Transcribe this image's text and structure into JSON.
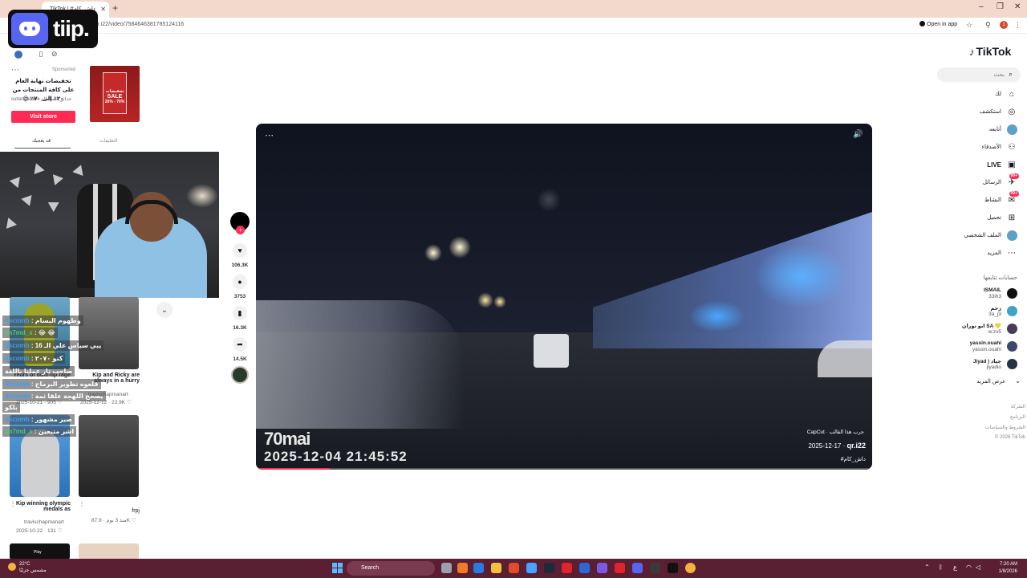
{
  "browser": {
    "tab_title": "TikTok | #داش_كام",
    "url": "qr.i22/video/7584646381785124116",
    "open_in_app": "Open in app",
    "notification_count": "1"
  },
  "overlay": {
    "logo_text": "tiip."
  },
  "ad": {
    "sponsored": "Sponsored",
    "text": "تخفيضات نهاية العام على كافة المنتجات من ٢٠٪ إلى ٧٠٪ 😍",
    "handle": "sultangarden",
    "handle_ar": "حدائق السلطان",
    "img_text": "SALE",
    "img_discount": "20% - 70%",
    "img_heading": "تخفيضات",
    "visit_label": "Visit store"
  },
  "left_tabs": {
    "tab1": "قد يعجبك",
    "tab2": "التعليقات"
  },
  "chat": [
    {
      "user": "itscomb",
      "msg": "وطهوم البسام",
      "user_class": "u"
    },
    {
      "user": "im7md_x",
      "msg": "😂 😂",
      "user_class": "u2"
    },
    {
      "user": "itscomb",
      "msg": "يبي سياس علي الـ 16",
      "user_class": "u"
    },
    {
      "user": "itscomb",
      "msg": "كنو ٢٠٧٠",
      "user_class": "u"
    },
    {
      "user": "",
      "msg": "صاحب ثار عملنا باللغة",
      "user_class": "u"
    },
    {
      "user": "itscomb",
      "msg": "قلعوه تطوير البرماج",
      "user_class": "u"
    },
    {
      "user": "itscomb",
      "msg": "يصحح اللهجة علقا ثمة",
      "user_class": "u"
    },
    {
      "user": "",
      "msg": "بلكو",
      "user_class": "u"
    },
    {
      "user": "itscomb",
      "msg": "صير مشهور",
      "user_class": "u"
    },
    {
      "user": "im7md_x",
      "msg": "اشر متبعين",
      "user_class": "u2"
    }
  ],
  "grid": [
    {
      "caption": "Years of built-up rage",
      "author": "",
      "date": "2025-10-21",
      "views": "905"
    },
    {
      "caption": "Kip and Ricky are always in a hurry",
      "author": "travischapmanart",
      "date": "2025-12-12",
      "views": "23.9K"
    },
    {
      "caption": "Kip winning olympic medals as",
      "author": "travischapmanart",
      "date": "2025-10-22",
      "views": "131"
    },
    {
      "caption": "frpj",
      "author": "",
      "date": "منذ 3 يوم",
      "views": "87.9K"
    }
  ],
  "grid_prefix": {
    "ellipsis": "...",
    "thumb5_text": "Play"
  },
  "actions": {
    "likes": "106.3K",
    "comments": "3753",
    "saves": "16.3K",
    "shares": "14.5K"
  },
  "player": {
    "watermark_brand": "70mai",
    "watermark_datetime": "2025-12-04   21:45:52",
    "capcut": "CapCut · جرب هذا القالب",
    "date": "2025-12-17",
    "author": "qr.i22",
    "hashtag": "#داش_كام",
    "progress": 0.12
  },
  "sidebar": {
    "logo": "TikTok",
    "search_placeholder": "بحث",
    "nav": [
      {
        "label": "لك",
        "icon": "⌂",
        "name": "home",
        "badge": ""
      },
      {
        "label": "استكشف",
        "icon": "◎",
        "name": "explore",
        "badge": ""
      },
      {
        "label": "أتابعه",
        "icon": "",
        "name": "following",
        "badge": "",
        "avatar": true
      },
      {
        "label": "الأصدقاء",
        "icon": "⚇",
        "name": "friends",
        "badge": ""
      },
      {
        "label": "LIVE",
        "icon": "▣",
        "name": "live",
        "badge": "",
        "bold": true
      },
      {
        "label": "الرسائل",
        "icon": "✈",
        "name": "messages",
        "badge": "99+"
      },
      {
        "label": "النشاط",
        "icon": "✉",
        "name": "activity",
        "badge": "99+"
      },
      {
        "label": "تحميل",
        "icon": "⊞",
        "name": "upload",
        "badge": ""
      },
      {
        "label": "الملف الشخصي",
        "icon": "",
        "name": "profile",
        "badge": "",
        "avatar": true
      },
      {
        "label": "المزيد",
        "icon": "⋯",
        "name": "more",
        "badge": ""
      }
    ],
    "following_title": "حسابات تتابعها",
    "accounts": [
      {
        "name": "ISMAIL",
        "handle": "33ih3",
        "color": "#111111"
      },
      {
        "name": "زحم",
        "handle": "3a_pl",
        "color": "#3da3c9"
      },
      {
        "name": "ابو نوران SA 💛",
        "handle": "w.zv5",
        "color": "#4a3a5a"
      },
      {
        "name": "yassin.ouahi",
        "handle": "yassin.ouahi",
        "color": "#3a4a6a"
      },
      {
        "name": "Jiyad | جياد",
        "handle": "jiyadio",
        "color": "#223344"
      }
    ],
    "see_more": "عرض المزيد",
    "footer": [
      "الشركة",
      "البرنامج",
      "الشروط والسياسات",
      "© 2026 TikTok"
    ]
  },
  "taskbar": {
    "temp": "22°C",
    "weather": "مشمس جزئيًا",
    "search": "Search",
    "time": "7:20 AM",
    "date": "1/8/2026"
  },
  "colors": {
    "accent": "#fe2c55",
    "taskbar": "#5a1f33",
    "tabbar": "#f2d9cc"
  }
}
